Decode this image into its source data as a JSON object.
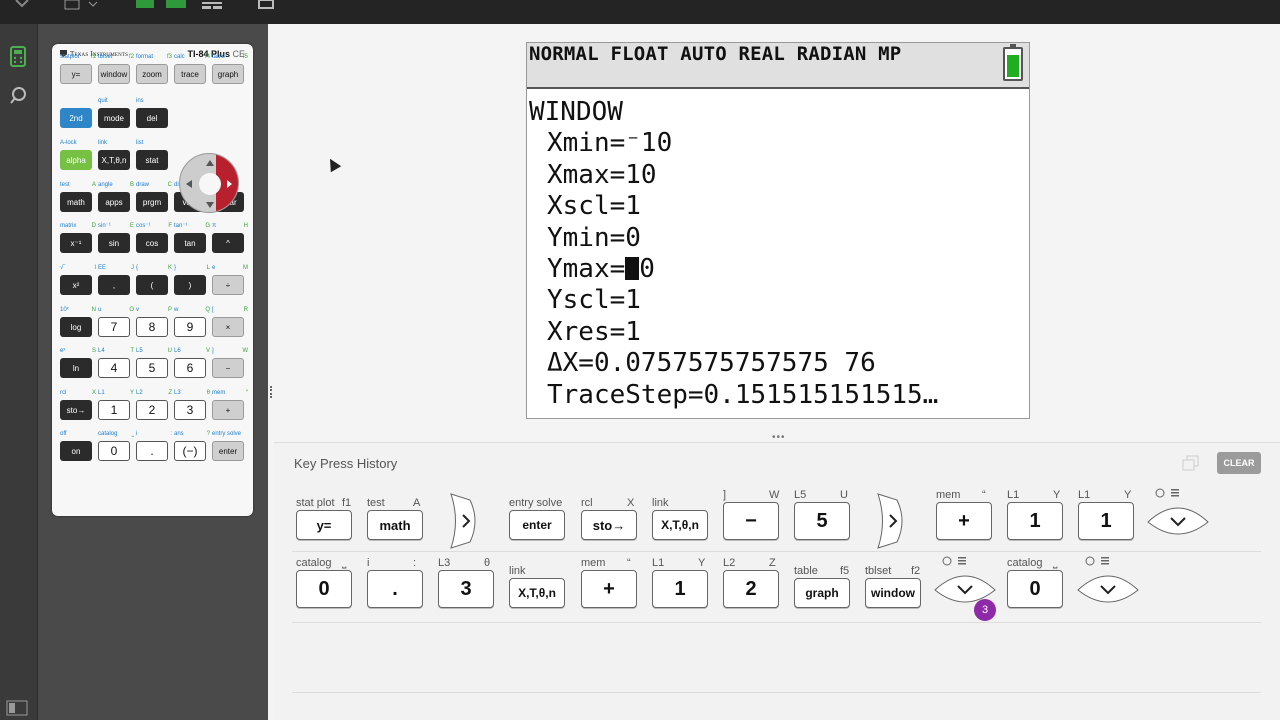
{
  "calculator": {
    "brand": "Texas Instruments",
    "model": "TI-84 Plus",
    "model_suffix": "CE",
    "keys": [
      {
        "label": "y=",
        "sub_left": "statplot",
        "sub_right": "f1"
      },
      {
        "label": "window",
        "sub_left": "tblset",
        "sub_right": "f2"
      },
      {
        "label": "zoom",
        "sub_left": "format",
        "sub_right": "f3"
      },
      {
        "label": "trace",
        "sub_left": "calc",
        "sub_right": "f4"
      },
      {
        "label": "graph",
        "sub_left": "table",
        "sub_right": "f5"
      },
      {
        "label": "2nd",
        "sub_left": "",
        "sub_right": ""
      },
      {
        "label": "mode",
        "sub_left": "quit",
        "sub_right": ""
      },
      {
        "label": "del",
        "sub_left": "ins",
        "sub_right": ""
      },
      {
        "label": "alpha",
        "sub_left": "A-lock",
        "sub_right": ""
      },
      {
        "label": "X,T,θ,n",
        "sub_left": "link",
        "sub_right": ""
      },
      {
        "label": "stat",
        "sub_left": "list",
        "sub_right": ""
      },
      {
        "label": "math",
        "sub_left": "test",
        "sub_right": "A"
      },
      {
        "label": "apps",
        "sub_left": "angle",
        "sub_right": "B"
      },
      {
        "label": "prgm",
        "sub_left": "draw",
        "sub_right": "C"
      },
      {
        "label": "vars",
        "sub_left": "distr",
        "sub_right": ""
      },
      {
        "label": "clear",
        "sub_left": "",
        "sub_right": ""
      },
      {
        "label": "x⁻¹",
        "sub_left": "matrix",
        "sub_right": "D"
      },
      {
        "label": "sin",
        "sub_left": "sin⁻¹",
        "sub_right": "E"
      },
      {
        "label": "cos",
        "sub_left": "cos⁻¹",
        "sub_right": "F"
      },
      {
        "label": "tan",
        "sub_left": "tan⁻¹",
        "sub_right": "G"
      },
      {
        "label": "^",
        "sub_left": "π",
        "sub_right": "H"
      },
      {
        "label": "x²",
        "sub_left": "√‾",
        "sub_right": "I"
      },
      {
        "label": ",",
        "sub_left": "EE",
        "sub_right": "J"
      },
      {
        "label": "(",
        "sub_left": "{",
        "sub_right": "K"
      },
      {
        "label": ")",
        "sub_left": "}",
        "sub_right": "L"
      },
      {
        "label": "÷",
        "sub_left": "e",
        "sub_right": "M"
      },
      {
        "label": "log",
        "sub_left": "10ˣ",
        "sub_right": "N"
      },
      {
        "label": "7",
        "sub_left": "u",
        "sub_right": "O"
      },
      {
        "label": "8",
        "sub_left": "v",
        "sub_right": "P"
      },
      {
        "label": "9",
        "sub_left": "w",
        "sub_right": "Q"
      },
      {
        "label": "×",
        "sub_left": "[",
        "sub_right": "R"
      },
      {
        "label": "ln",
        "sub_left": "eˣ",
        "sub_right": "S"
      },
      {
        "label": "4",
        "sub_left": "L4",
        "sub_right": "T"
      },
      {
        "label": "5",
        "sub_left": "L5",
        "sub_right": "U"
      },
      {
        "label": "6",
        "sub_left": "L6",
        "sub_right": "V"
      },
      {
        "label": "−",
        "sub_left": "]",
        "sub_right": "W"
      },
      {
        "label": "sto→",
        "sub_left": "rcl",
        "sub_right": "X"
      },
      {
        "label": "1",
        "sub_left": "L1",
        "sub_right": "Y"
      },
      {
        "label": "2",
        "sub_left": "L2",
        "sub_right": "Z"
      },
      {
        "label": "3",
        "sub_left": "L3",
        "sub_right": "θ"
      },
      {
        "label": "+",
        "sub_left": "mem",
        "sub_right": "“"
      },
      {
        "label": "on",
        "sub_left": "off",
        "sub_right": ""
      },
      {
        "label": "0",
        "sub_left": "catalog",
        "sub_right": "⎵"
      },
      {
        "label": ".",
        "sub_left": "i",
        "sub_right": ":"
      },
      {
        "label": "(−)",
        "sub_left": "ans",
        "sub_right": "?"
      },
      {
        "label": "enter",
        "sub_left": "entry solve",
        "sub_right": ""
      }
    ]
  },
  "screen": {
    "mode_line": "NORMAL FLOAT AUTO REAL RADIAN MP",
    "title": "WINDOW",
    "lines": [
      "Xmin=⁻10",
      "Xmax=10",
      "Xscl=1",
      "Ymin=0",
      "Ymax=",
      "Yscl=1",
      "Xres=1",
      "ΔX=0.0757575757575 76",
      "TraceStep=0.151515151515…"
    ],
    "ymax_after_cursor": "0"
  },
  "history": {
    "title": "Key Press History",
    "clear_label": "CLEAR",
    "badge": "3",
    "row1": [
      {
        "label": "y=",
        "sub_left": "stat plot",
        "sub_right": "f1"
      },
      {
        "label": "math",
        "sub_left": "test",
        "sub_right": "A"
      },
      {
        "label": "right-arrow",
        "sub_left": "",
        "sub_right": ""
      },
      {
        "label": "enter",
        "sub_left": "entry solve",
        "sub_right": ""
      },
      {
        "label": "sto→",
        "sub_left": "rcl",
        "sub_right": "X"
      },
      {
        "label": "X,T,θ,n",
        "sub_left": "link",
        "sub_right": ""
      },
      {
        "label": "−",
        "sub_left": "]",
        "sub_right": "W"
      },
      {
        "label": "5",
        "sub_left": "L5",
        "sub_right": "U"
      },
      {
        "label": "right-arrow",
        "sub_left": "",
        "sub_right": ""
      },
      {
        "label": "+",
        "sub_left": "mem",
        "sub_right": "“"
      },
      {
        "label": "1",
        "sub_left": "L1",
        "sub_right": "Y"
      },
      {
        "label": "1",
        "sub_left": "L1",
        "sub_right": "Y"
      },
      {
        "label": "down-arrow",
        "sub_left": "",
        "sub_right": ""
      }
    ],
    "row2": [
      {
        "label": "0",
        "sub_left": "catalog",
        "sub_right": "⎵"
      },
      {
        "label": ".",
        "sub_left": "i",
        "sub_right": ":"
      },
      {
        "label": "3",
        "sub_left": "L3",
        "sub_right": "θ"
      },
      {
        "label": "X,T,θ,n",
        "sub_left": "link",
        "sub_right": ""
      },
      {
        "label": "+",
        "sub_left": "mem",
        "sub_right": "“"
      },
      {
        "label": "1",
        "sub_left": "L1",
        "sub_right": "Y"
      },
      {
        "label": "2",
        "sub_left": "L2",
        "sub_right": "Z"
      },
      {
        "label": "graph",
        "sub_left": "table",
        "sub_right": "f5"
      },
      {
        "label": "window",
        "sub_left": "tblset",
        "sub_right": "f2"
      },
      {
        "label": "down-arrow",
        "sub_left": "",
        "sub_right": ""
      },
      {
        "label": "0",
        "sub_left": "catalog",
        "sub_right": "⎵"
      },
      {
        "label": "down-arrow",
        "sub_left": "",
        "sub_right": ""
      }
    ]
  }
}
